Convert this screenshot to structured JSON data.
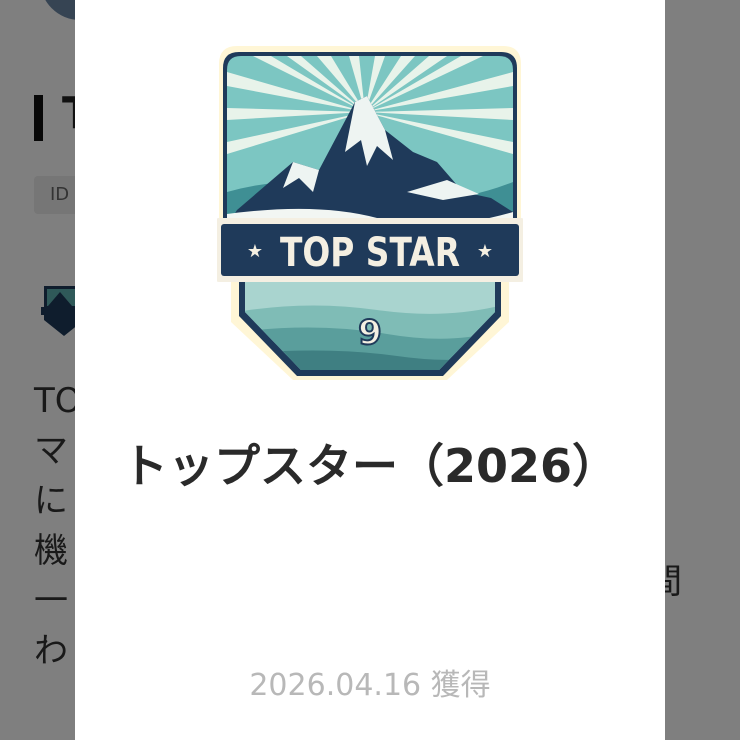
{
  "background": {
    "title_fragment": "T",
    "id_label": "ID",
    "text_lines": [
      "TO",
      "マ",
      "に",
      "機",
      "一",
      "わ"
    ],
    "right_fragment": "間"
  },
  "modal": {
    "badge": {
      "banner_text": "TOP STAR",
      "level": "9",
      "colors": {
        "navy": "#1f3a5a",
        "teal": "#5fb3b3",
        "cream": "#fff6d6"
      }
    },
    "title": "トップスター（2026）",
    "date": "2026.04.16 獲得"
  }
}
